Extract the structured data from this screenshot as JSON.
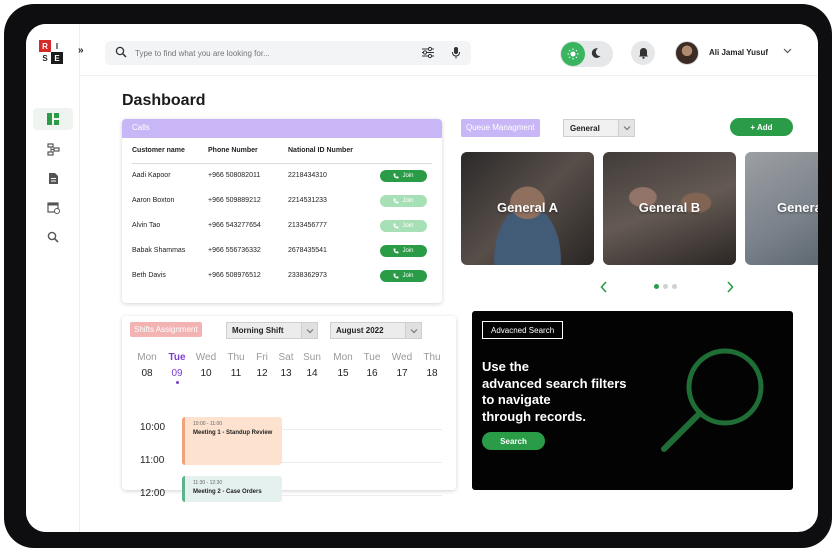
{
  "logo": {
    "letters": [
      "R",
      "I",
      "S",
      "E"
    ]
  },
  "topbar": {
    "search_placeholder": "Type to find what you are looking for...",
    "user_name": "Ali Jamal Yusuf",
    "collapse_icon": "»"
  },
  "page": {
    "title": "Dashboard"
  },
  "calls": {
    "title": "Calls",
    "columns": [
      "Customer name",
      "Phone Number",
      "National ID Number",
      ""
    ],
    "join_label": "Join",
    "rows": [
      {
        "name": "Aadi Kapoor",
        "phone": "+966 508082011",
        "nid": "2218434310",
        "join_enabled": true
      },
      {
        "name": "Aaron Boxton",
        "phone": "+966 509889212",
        "nid": "2214531233",
        "join_enabled": false
      },
      {
        "name": "Alvin Tao",
        "phone": "+966 543277654",
        "nid": "2133456777",
        "join_enabled": false
      },
      {
        "name": "Babak Shammas",
        "phone": "+966 556736332",
        "nid": "2678435541",
        "join_enabled": true
      },
      {
        "name": "Beth Davis",
        "phone": "+966 508976512",
        "nid": "2338362973",
        "join_enabled": true
      }
    ]
  },
  "queue": {
    "label": "Queue Managment",
    "selected": "General",
    "add_label": "+ Add",
    "tiles": [
      "General A",
      "General B",
      "General C"
    ],
    "carousel": {
      "pages": 3,
      "active": 1
    }
  },
  "shifts": {
    "label": "Shifts Assignment",
    "shift_selected": "Morning Shift",
    "month_selected": "August 2022",
    "days": [
      {
        "name": "Mon",
        "date": "08"
      },
      {
        "name": "Tue",
        "date": "09",
        "today": true
      },
      {
        "name": "Wed",
        "date": "10"
      },
      {
        "name": "Thu",
        "date": "11"
      },
      {
        "name": "Fri",
        "date": "12"
      },
      {
        "name": "Sat",
        "date": "13"
      },
      {
        "name": "Sun",
        "date": "14"
      },
      {
        "name": "Mon",
        "date": "15"
      },
      {
        "name": "Tue",
        "date": "16"
      },
      {
        "name": "Wed",
        "date": "17"
      },
      {
        "name": "Thu",
        "date": "18"
      }
    ],
    "times": [
      "10:00",
      "11:00",
      "12:00"
    ],
    "events": [
      {
        "time": "10:00 - 11:00",
        "name": "Meeting 1 - Standup Review"
      },
      {
        "time": "11:30 - 12:30",
        "name": "Meeting 2 - Case Orders"
      }
    ]
  },
  "advanced": {
    "tag": "Advacned Search",
    "text_lines": [
      "Use the",
      "advanced search filters",
      "to navigate",
      "through records."
    ],
    "button": "Search"
  },
  "colors": {
    "accent": "#2a9c48",
    "purple": "#c8b6f7",
    "pink": "#f4b3b3"
  }
}
